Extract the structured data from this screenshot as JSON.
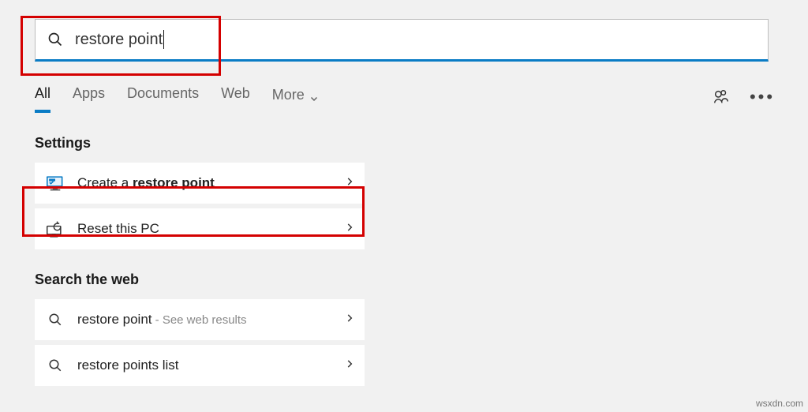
{
  "search": {
    "value": "restore point"
  },
  "tabs": {
    "items": [
      {
        "label": "All",
        "active": true
      },
      {
        "label": "Apps",
        "active": false
      },
      {
        "label": "Documents",
        "active": false
      },
      {
        "label": "Web",
        "active": false
      },
      {
        "label": "More",
        "active": false,
        "hasChevron": true
      }
    ]
  },
  "sections": {
    "settings": {
      "title": "Settings",
      "items": [
        {
          "pre": "Create a ",
          "bold": "restore point",
          "post": ""
        },
        {
          "pre": "Reset this PC",
          "bold": "",
          "post": ""
        }
      ]
    },
    "web": {
      "title": "Search the web",
      "items": [
        {
          "pre": "restore point",
          "bold": "",
          "post": " - See web results"
        },
        {
          "pre": "restore points list",
          "bold": "",
          "post": ""
        }
      ]
    }
  },
  "watermark": "wsxdn.com"
}
